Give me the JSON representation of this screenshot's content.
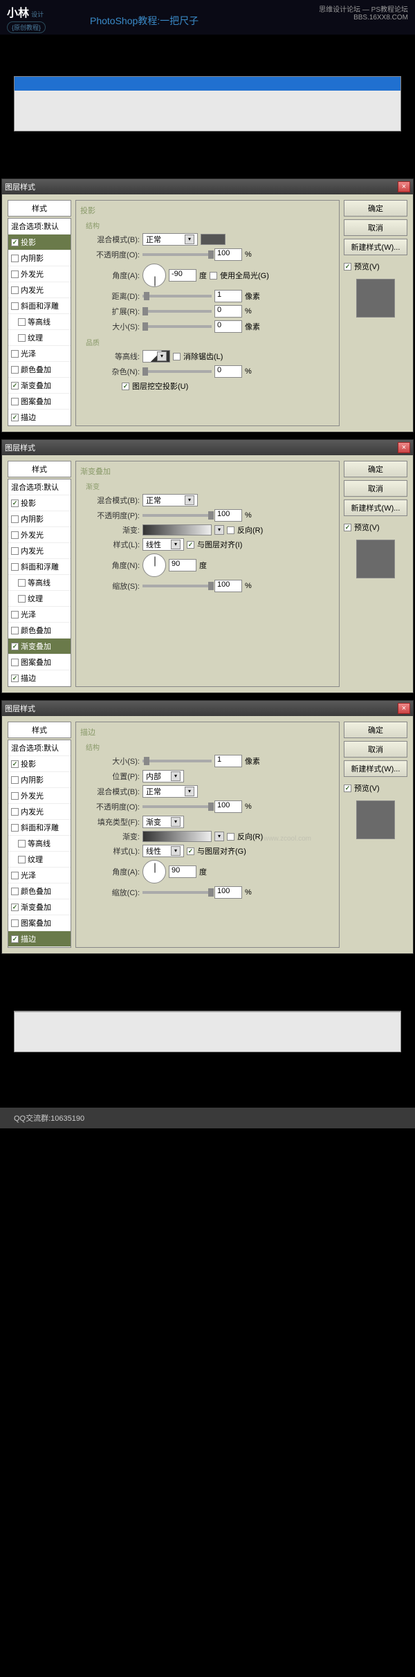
{
  "header": {
    "logo": "小林",
    "logo_suffix": "设计",
    "badge": "{原创教程}",
    "title": "PhotoShop教程:一把尺子",
    "watermark_text": "思维设计论坛 — PS教程论坛",
    "watermark_url": "BBS.16XX8.COM"
  },
  "styles_panel": {
    "header": "样式",
    "blend_option": "混合选项:默认",
    "items": [
      {
        "label": "投影",
        "checked": true,
        "indent": false
      },
      {
        "label": "内阴影",
        "checked": false,
        "indent": false
      },
      {
        "label": "外发光",
        "checked": false,
        "indent": false
      },
      {
        "label": "内发光",
        "checked": false,
        "indent": false
      },
      {
        "label": "斜面和浮雕",
        "checked": false,
        "indent": false
      },
      {
        "label": "等高线",
        "checked": false,
        "indent": true
      },
      {
        "label": "纹理",
        "checked": false,
        "indent": true
      },
      {
        "label": "光泽",
        "checked": false,
        "indent": false
      },
      {
        "label": "颜色叠加",
        "checked": false,
        "indent": false
      },
      {
        "label": "渐变叠加",
        "checked": true,
        "indent": false
      },
      {
        "label": "图案叠加",
        "checked": false,
        "indent": false
      },
      {
        "label": "描边",
        "checked": true,
        "indent": false
      }
    ]
  },
  "dialog_title": "图层样式",
  "buttons": {
    "ok": "确定",
    "cancel": "取消",
    "new_style": "新建样式(W)...",
    "preview": "预览(V)"
  },
  "panel1": {
    "title": "投影",
    "structure": "结构",
    "blend_mode_label": "混合模式(B):",
    "blend_mode": "正常",
    "opacity_label": "不透明度(O):",
    "opacity": "100",
    "angle_label": "角度(A):",
    "angle": "-90",
    "angle_unit": "度",
    "global_light": "使用全局光(G)",
    "distance_label": "距离(D):",
    "distance": "1",
    "pixels": "像素",
    "spread_label": "扩展(R):",
    "spread": "0",
    "size_label": "大小(S):",
    "size": "0",
    "quality": "品质",
    "contour_label": "等高线:",
    "antialias": "消除锯齿(L)",
    "noise_label": "杂色(N):",
    "noise": "0",
    "knockout": "图层挖空投影(U)",
    "percent": "%"
  },
  "panel2": {
    "title": "渐变叠加",
    "gradient_section": "渐变",
    "blend_mode_label": "混合模式(B):",
    "blend_mode": "正常",
    "opacity_label": "不透明度(P):",
    "opacity": "100",
    "gradient_label": "渐变:",
    "reverse": "反向(R)",
    "style_label": "样式(L):",
    "style": "线性",
    "align": "与图层对齐(I)",
    "angle_label": "角度(N):",
    "angle": "90",
    "angle_unit": "度",
    "scale_label": "缩放(S):",
    "scale": "100",
    "percent": "%"
  },
  "panel3": {
    "title": "描边",
    "structure": "结构",
    "size_label": "大小(S):",
    "size": "1",
    "pixels": "像素",
    "position_label": "位置(P):",
    "position": "内部",
    "blend_mode_label": "混合模式(B):",
    "blend_mode": "正常",
    "opacity_label": "不透明度(O):",
    "opacity": "100",
    "fill_type_label": "填充类型(F):",
    "fill_type": "渐变",
    "gradient_label": "渐变:",
    "reverse": "反向(R)",
    "style_label": "样式(L):",
    "style": "线性",
    "align": "与图层对齐(G)",
    "angle_label": "角度(A):",
    "angle": "90",
    "angle_unit": "度",
    "scale_label": "缩放(C):",
    "scale": "100",
    "percent": "%"
  },
  "watermark_body": "www.zcool.com",
  "footer": {
    "qq": "QQ交流群:10635190"
  }
}
